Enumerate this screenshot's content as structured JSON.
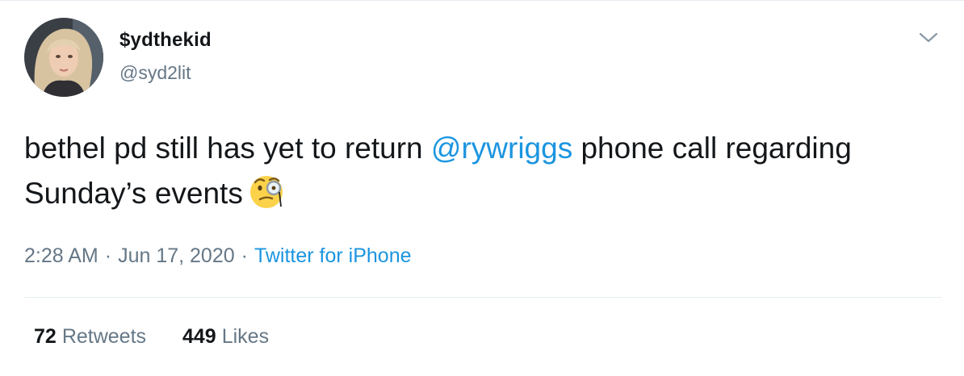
{
  "user": {
    "display_name": "$ydthekid",
    "handle": "@syd2lit",
    "avatar_icon": "profile-photo"
  },
  "menu": {
    "icon": "chevron-down-icon"
  },
  "tweet": {
    "text_before": "bethel pd still has yet to return ",
    "mention": "@rywriggs",
    "text_after": " phone call regarding Sunday’s events",
    "emoji": "face-with-monocle"
  },
  "meta": {
    "time": "2:28 AM",
    "separator": "·",
    "date": "Jun 17, 2020",
    "source": "Twitter for iPhone"
  },
  "stats": {
    "retweets_count": "72",
    "retweets_label": "Retweets",
    "likes_count": "449",
    "likes_label": "Likes"
  },
  "colors": {
    "link": "#1b95e0",
    "text": "#14171a",
    "muted": "#657786",
    "border": "#e6ecf0"
  }
}
